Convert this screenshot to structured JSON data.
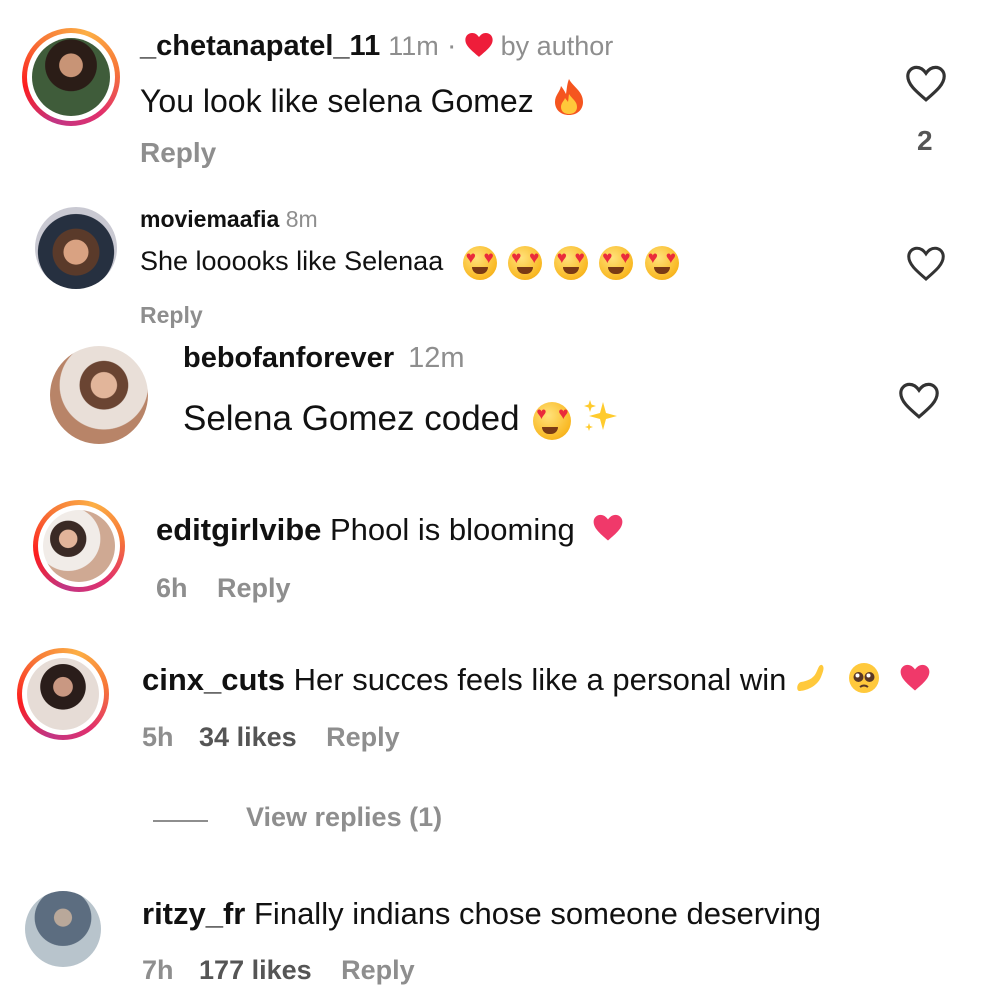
{
  "colors": {
    "accent_red": "#ee1d3a",
    "meta_gray": "#8e8e8e",
    "text": "#111111",
    "pink_heart": "#f0396a"
  },
  "comments": [
    {
      "username": "_chetanapatel_11",
      "time": "11m",
      "separator": "·",
      "liked_by_author": "by author",
      "text": "You look like selena Gomez",
      "reply_label": "Reply",
      "like_count": "2",
      "emoji": "fire-icon"
    },
    {
      "username": "moviemaafia",
      "time": "8m",
      "text": "She looooks like Selenaa",
      "reply_label": "Reply",
      "emoji": "heart-eyes-emoji x5"
    },
    {
      "username": "bebofanforever",
      "time": "12m",
      "text": "Selena Gomez coded",
      "emoji": "heart-eyes-emoji, sparkles-emoji"
    },
    {
      "username": "editgirlvibe",
      "text": "Phool is blooming",
      "time": "6h",
      "reply_label": "Reply",
      "emoji": "pink-heart-emoji"
    },
    {
      "username": "cinx_cuts",
      "text": "Her succes feels like a personal win",
      "time": "5h",
      "likes": "34 likes",
      "reply_label": "Reply",
      "emoji": "pinching-hand-emoji, pleading-face-emoji, red-heart-emoji"
    },
    {
      "view_replies": "View replies (1)"
    },
    {
      "username": "ritzy_fr",
      "text": "Finally indians chose someone deserving",
      "time": "7h",
      "likes": "177 likes",
      "reply_label": "Reply"
    }
  ]
}
